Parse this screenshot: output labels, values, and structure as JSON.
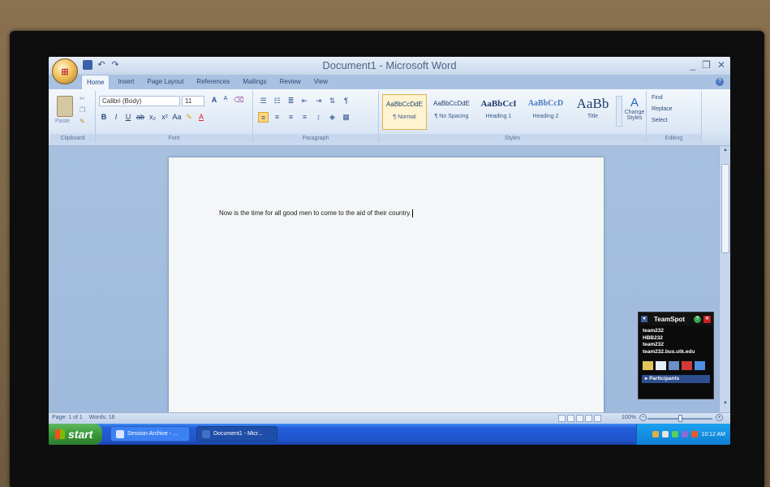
{
  "window": {
    "title": "Document1 - Microsoft Word"
  },
  "ribbon": {
    "tabs": [
      "Home",
      "Insert",
      "Page Layout",
      "References",
      "Mailings",
      "Review",
      "View"
    ],
    "clipboard": {
      "paste_label": "Paste",
      "group_label": "Clipboard"
    },
    "font": {
      "name": "Calibri (Body)",
      "size": "11",
      "group_label": "Font"
    },
    "paragraph": {
      "group_label": "Paragraph"
    },
    "styles": {
      "group_label": "Styles",
      "items": [
        {
          "sample": "AaBbCcDdE",
          "name": "¶ Normal"
        },
        {
          "sample": "AaBbCcDdE",
          "name": "¶ No Spacing"
        },
        {
          "sample": "AaBbCcI",
          "name": "Heading 1"
        },
        {
          "sample": "AaBbCcD",
          "name": "Heading 2"
        },
        {
          "sample": "AaBb",
          "name": "Title"
        }
      ],
      "change_styles": "Change Styles"
    },
    "editing": {
      "find": "Find",
      "replace": "Replace",
      "select": "Select",
      "group_label": "Editing"
    }
  },
  "document": {
    "text": "Now is the time for all good men to come to the aid of their country."
  },
  "teamspot": {
    "title": "TeamSpot",
    "lines": [
      "team232",
      "HBB232",
      "team232",
      "team232.bus.utk.edu"
    ],
    "participants": "Participants"
  },
  "statusbar": {
    "page": "Page: 1 of 1",
    "words": "Words: 16",
    "zoom": "100%"
  },
  "taskbar": {
    "start": "start",
    "tasks": [
      "Session Archive - ...",
      "Document1 - Micr..."
    ],
    "clock": "10:12 AM"
  }
}
